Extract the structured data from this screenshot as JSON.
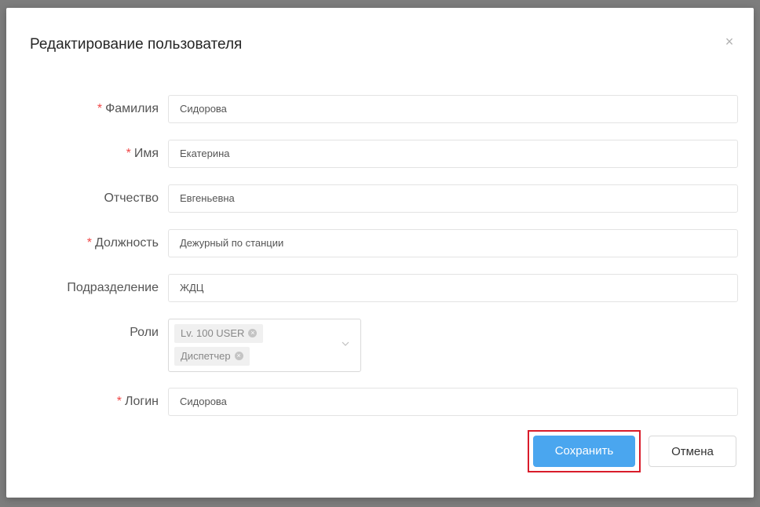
{
  "dialog": {
    "title": "Редактирование пользователя",
    "close_glyph": "×"
  },
  "form": {
    "required_mark": "*",
    "fields": {
      "last_name": {
        "label": "Фамилия",
        "value": "Сидорова",
        "required": true
      },
      "first_name": {
        "label": "Имя",
        "value": "Екатерина",
        "required": true
      },
      "patronymic": {
        "label": "Отчество",
        "value": "Евгеньевна",
        "required": false
      },
      "position": {
        "label": "Должность",
        "value": "Дежурный по станции",
        "required": true
      },
      "department": {
        "label": "Подразделение",
        "value": "ЖДЦ",
        "required": false
      },
      "roles": {
        "label": "Роли",
        "required": false,
        "selected": [
          "Lv. 100 USER",
          "Диспетчер"
        ],
        "remove_glyph": "×"
      },
      "login": {
        "label": "Логин",
        "value": "Сидорова",
        "required": true
      }
    }
  },
  "actions": {
    "save_label": "Сохранить",
    "cancel_label": "Отмена"
  },
  "colors": {
    "overlay": "#7d7d7d",
    "primary": "#4aa6ef",
    "required": "#f04848",
    "highlight": "#d91c2a"
  },
  "icons": {
    "close": "close-icon",
    "dropdown": "chevron-down-icon",
    "tag_remove": "tag-remove-icon"
  }
}
